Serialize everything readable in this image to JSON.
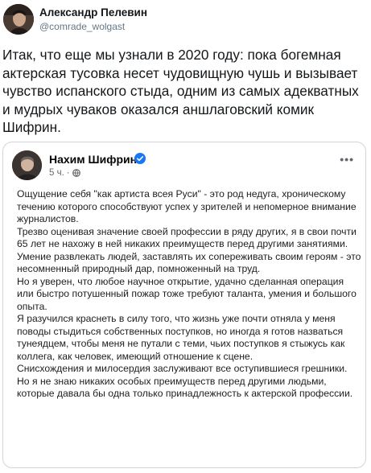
{
  "tweet": {
    "author_name": "Александр Пелевин",
    "author_handle": "@comrade_wolgast",
    "text": "Итак, что еще мы узнали в 2020 году: пока богемная актерская тусовка несет чудовищную чушь и вызывает чувство испанского стыда, одним из самых адекватных и мудрых чуваков оказался аншлаговский комик Шифрин."
  },
  "embed": {
    "author_name": "Нахим Шифрин",
    "verified_icon": "verified-check-icon",
    "time": "5 ч.",
    "separator": "·",
    "privacy_icon": "globe-icon",
    "more_label": "•••",
    "paragraphs": [
      "Ощущение себя \"как артиста всея Руси\" - это род недуга, хроническому течению которого способствуют успех у зрителей и непомерное внимание журналистов.",
      "Трезво оценивая значение своей профессии в ряду других, я в свои почти 65 лет не нахожу в ней никаких преимуществ перед другими занятиями. Умение развлекать людей, заставлять их сопереживать своим героям - это несомненный природный дар, помноженный на труд.",
      "Но я уверен, что любое научное открытие, удачно сделанная операция или быстро потушенный пожар тоже требуют таланта, умения и большого опыта.",
      "Я разучился краснеть в силу того, что жизнь уже почти отняла у меня поводы стыдиться собственных поступков, но иногда я готов назваться тунеядцем, чтобы меня не путали с теми, чьих поступков я стыжусь как коллега, как  человек, имеющий отношение к сцене.",
      "Снисхождения и милосердия заслуживают все оступившиеся грешники. Но я не знаю никаких особых преимуществ перед другими людьми, которые давала бы одна только принадлежность к актерской профессии."
    ]
  },
  "colors": {
    "verified": "#1877f2",
    "muted_text": "#657786",
    "border": "#d4d4d4"
  }
}
